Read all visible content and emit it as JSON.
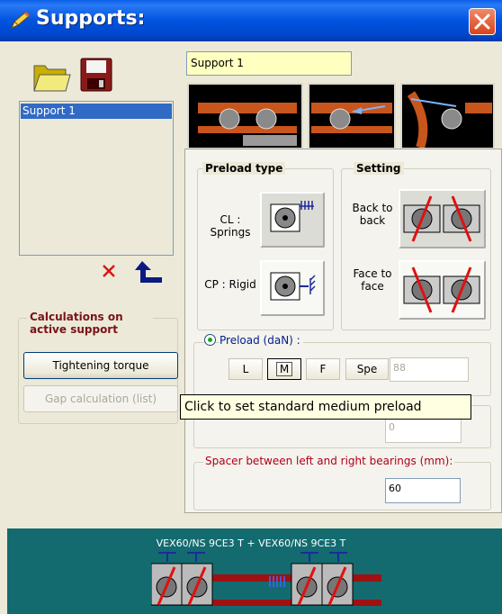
{
  "window": {
    "title": "Supports:"
  },
  "supports": {
    "items": [
      "Support 1"
    ],
    "selected_name": "Support 1"
  },
  "calc_group": {
    "legend": "Calculations on active support",
    "tightening_label": "Tightening torque",
    "gap_label": "Gap calculation (list)"
  },
  "preload_type": {
    "legend": "Preload type",
    "cl_label": "CL : Springs",
    "cp_label": "CP : Rigid"
  },
  "setting": {
    "legend": "Setting",
    "back_label": "Back to back",
    "face_label": "Face to face"
  },
  "preload": {
    "label": "Preload (daN) :",
    "buttons": [
      "L",
      "M",
      "F",
      "Spe"
    ],
    "selected": "M",
    "value": "88"
  },
  "gap_field": {
    "value": "0"
  },
  "spacer": {
    "label": "Spacer between left and right bearings (mm):",
    "value": "60"
  },
  "tooltip": {
    "text": "Click to set standard medium preload"
  },
  "assembly": {
    "description": "VEX60/NS 9CE3 T + VEX60/NS 9CE3 T"
  },
  "colors": {
    "title_bar": "#0053e0",
    "selection": "#316ac5",
    "legend_text": "#7a1218",
    "bottom_panel": "#136b6f"
  }
}
